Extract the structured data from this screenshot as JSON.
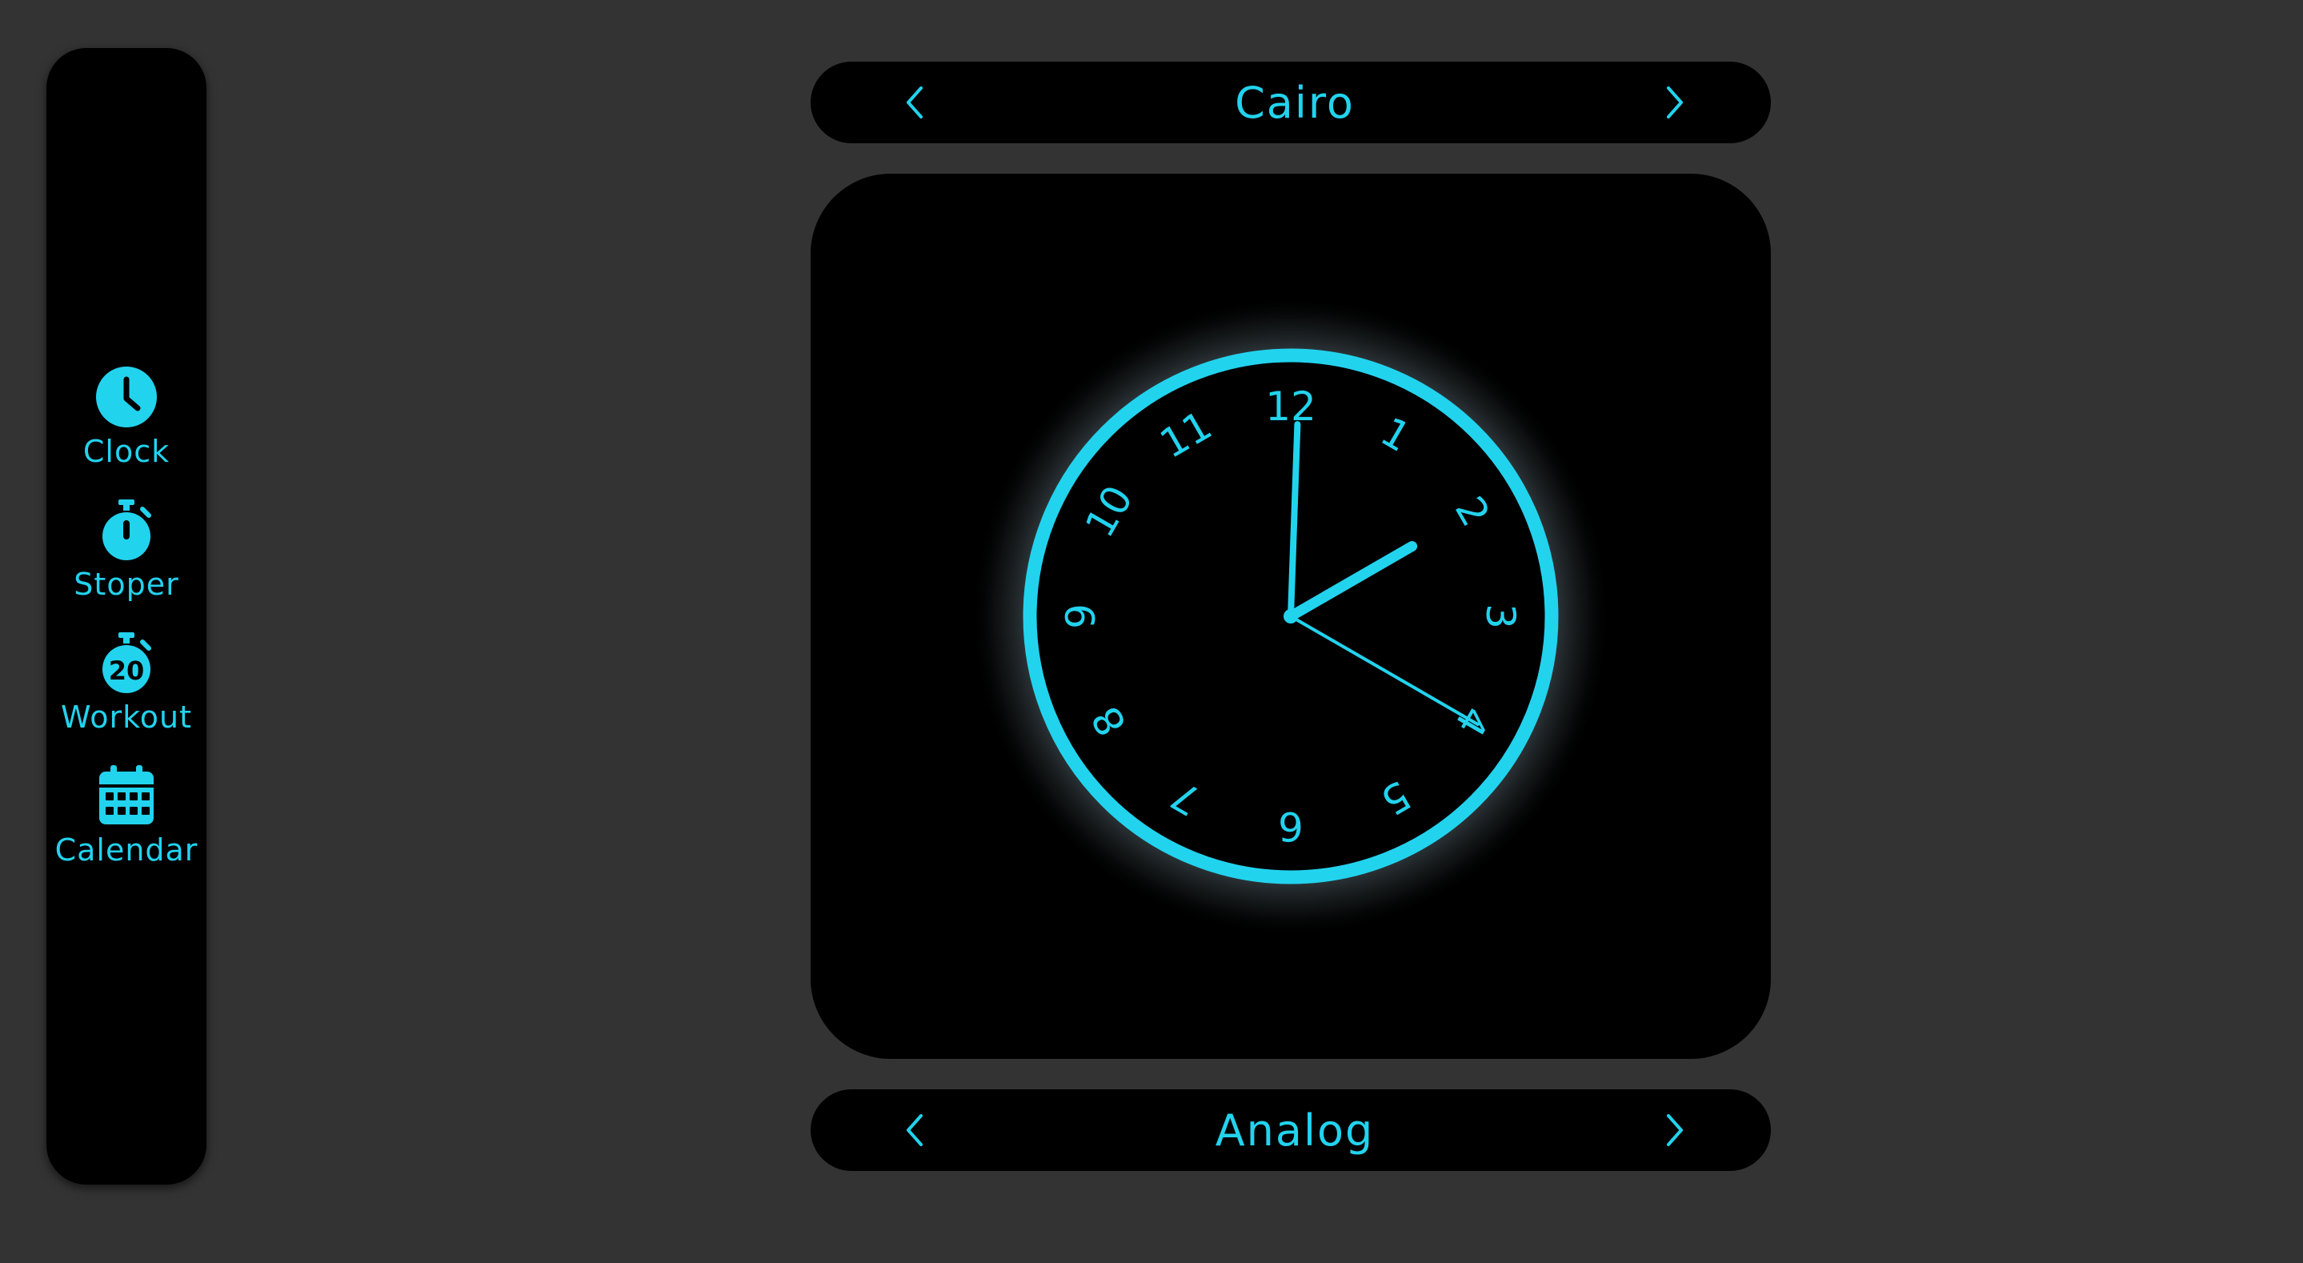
{
  "sidebar": {
    "items": [
      {
        "label": "Clock",
        "icon": "clock-icon"
      },
      {
        "label": "Stoper",
        "icon": "stopwatch-icon"
      },
      {
        "label": "Workout",
        "icon": "workout-timer-icon",
        "badge": "20"
      },
      {
        "label": "Calendar",
        "icon": "calendar-icon"
      }
    ]
  },
  "city_selector": {
    "value": "Cairo",
    "prev_icon": "chevron-left-icon",
    "next_icon": "chevron-right-icon"
  },
  "mode_selector": {
    "value": "Analog",
    "prev_icon": "chevron-left-icon",
    "next_icon": "chevron-right-icon"
  },
  "clock": {
    "numerals": [
      "12",
      "1",
      "2",
      "3",
      "4",
      "5",
      "6",
      "7",
      "8",
      "9",
      "10",
      "11"
    ],
    "time": {
      "hour": 2,
      "minute": 0,
      "second": 20
    }
  },
  "colors": {
    "accent": "#22d3ee",
    "panel": "#000000",
    "background": "#333333"
  }
}
